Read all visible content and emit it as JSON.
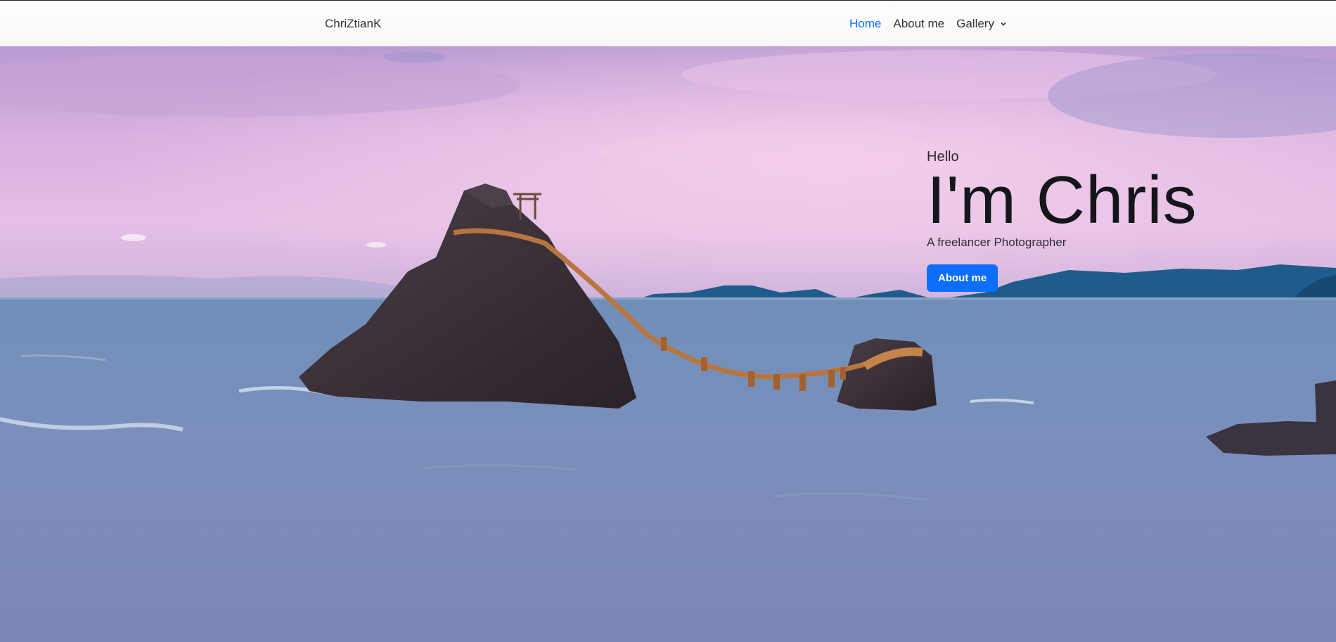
{
  "navbar": {
    "brand": "ChriZtianK",
    "links": [
      {
        "label": "Home",
        "active": true
      },
      {
        "label": "About me",
        "active": false
      }
    ],
    "dropdown": {
      "label": "Gallery",
      "icon": "chevron-down-icon"
    }
  },
  "hero": {
    "greeting": "Hello",
    "headline": "I'm Chris",
    "tagline": "A freelancer Photographer",
    "cta_label": "About me"
  },
  "colors": {
    "accent": "#0d6efd",
    "sky_top": "#b28fc8",
    "sky_glow": "#f1c7e6",
    "sea": "#6d8cb4",
    "mountains": "#1f5a8a",
    "rock": "#3a2f36",
    "rope": "#b8753f"
  }
}
